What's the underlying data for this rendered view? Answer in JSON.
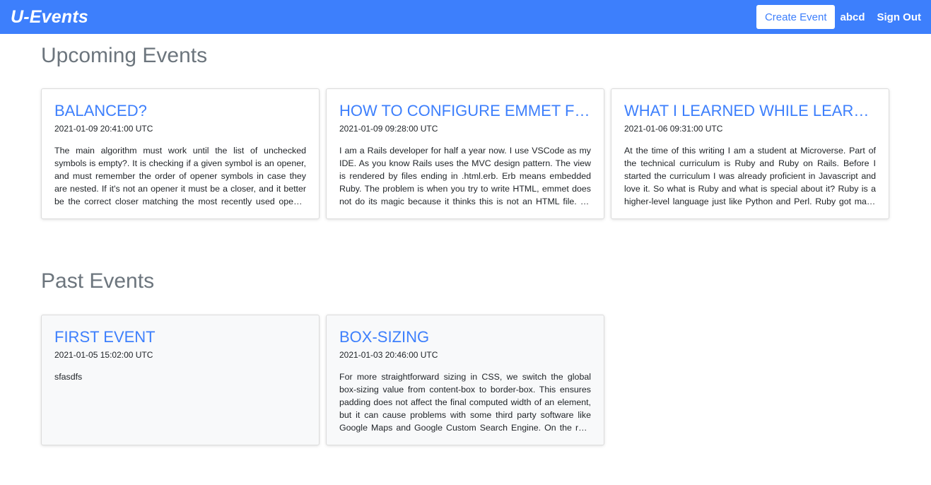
{
  "navbar": {
    "brand": "U-Events",
    "create_label": "Create Event",
    "username": "abcd",
    "signout_label": "Sign Out"
  },
  "upcoming": {
    "title": "Upcoming Events",
    "events": [
      {
        "title": "BALANCED?",
        "date": "2021-01-09 20:41:00 UTC",
        "body": "The main algorithm must work until the list of unchecked symbols is empty?. It is checking if a given symbol is an opener, and must remember the order of opener symbols in case they are nested. If it's not an opener it must be a closer, and it better be the correct closer matching the most recently used opener and then the list must be checked."
      },
      {
        "title": "HOW TO CONFIGURE EMMET FOR ERB",
        "date": "2021-01-09 09:28:00 UTC",
        "body": "I am a Rails developer for half a year now. I use VSCode as my IDE. As you know Rails uses the MVC design pattern. The view is rendered by files ending in .html.erb. Erb means embedded Ruby. The problem is when you try to write HTML, emmet does not do its magic because it thinks this is not an HTML file. So how do we fix it."
      },
      {
        "title": "WHAT I LEARNED WHILE LEARNING RUBY",
        "date": "2021-01-06 09:31:00 UTC",
        "body": "At the time of this writing I am a student at Microverse. Part of the technical curriculum is Ruby and Ruby on Rails. Before I started the curriculum I was already proficient in Javascript and love it. So what is Ruby and what is special about it? Ruby is a higher-level language just like Python and Perl. Ruby got many things right."
      }
    ]
  },
  "past": {
    "title": "Past Events",
    "events": [
      {
        "title": "FIRST EVENT",
        "date": "2021-01-05 15:02:00 UTC",
        "body": "sfasdfs"
      },
      {
        "title": "BOX-SIZING",
        "date": "2021-01-03 20:46:00 UTC",
        "body": "For more straightforward sizing in CSS, we switch the global box-sizing value from content-box to border-box. This ensures padding does not affect the final computed width of an element, but it can cause problems with some third party software like Google Maps and Google Custom Search Engine. On the rare occasion you need to override it."
      }
    ]
  },
  "colors": {
    "primary": "#3d7ffc",
    "heading": "#6c757d",
    "past_card_bg": "#f8f9fa"
  }
}
